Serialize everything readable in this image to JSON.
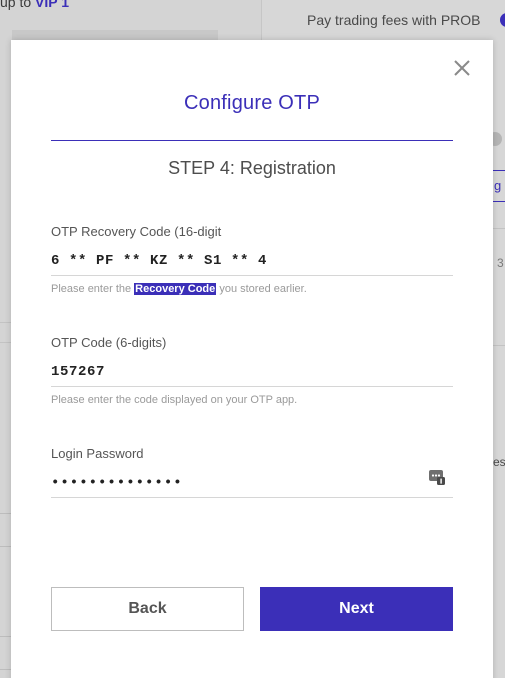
{
  "background": {
    "vip_prefix": "up to",
    "vip_level": "VIP 1",
    "fees_text": "Pay trading fees with PROB",
    "outline_btn_fragment": "g",
    "side_number": "3",
    "side_text": "es"
  },
  "modal": {
    "title": "Configure OTP",
    "step": "STEP 4: Registration",
    "recovery": {
      "label": "OTP Recovery Code (16-digit",
      "value": "6 ** PF ** KZ ** S1 ** 4",
      "help_before": "Please enter the ",
      "help_highlight": "Recovery Code",
      "help_after": " you stored earlier."
    },
    "otp": {
      "label": "OTP Code (6-digits)",
      "value": "157267",
      "help": "Please enter the code displayed on your OTP app."
    },
    "password": {
      "label": "Login Password",
      "value": "••••••••••••••"
    },
    "buttons": {
      "back": "Back",
      "next": "Next"
    }
  },
  "colors": {
    "accent": "#3b2fb8",
    "muted_text": "#9a9a9a",
    "divider": "#d6d6d6"
  },
  "icons": {
    "close": "close-icon",
    "password_manager": "password-manager-icon"
  }
}
